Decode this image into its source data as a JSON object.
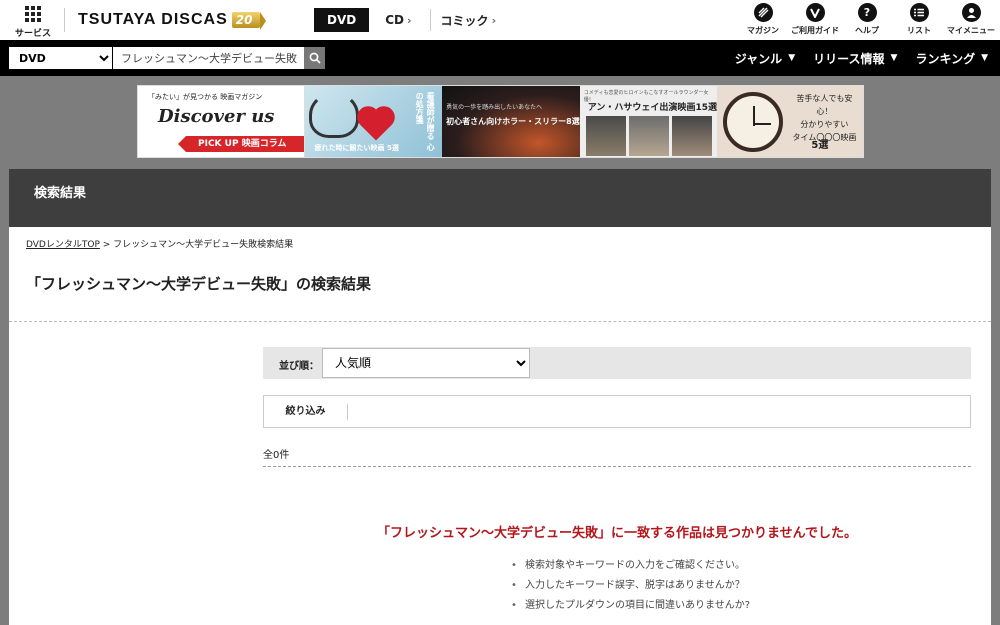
{
  "header": {
    "services_label": "サービス",
    "logo_text": "TSUTAYA DISCAS",
    "logo_badge": "20",
    "category_tabs": [
      {
        "label": "DVD"
      },
      {
        "label": "CD"
      },
      {
        "label": "コミック"
      }
    ],
    "util_nav": [
      {
        "label": "マガジン",
        "icon": "magazine-icon"
      },
      {
        "label": "ご利用ガイド",
        "icon": "guide-icon"
      },
      {
        "label": "ヘルプ",
        "icon": "help-icon"
      },
      {
        "label": "リスト",
        "icon": "list-icon"
      },
      {
        "label": "マイメニュー",
        "icon": "user-icon"
      }
    ]
  },
  "searchbar": {
    "media_selected": "DVD",
    "query": "フレッシュマン～大学デビュー失敗",
    "nav": [
      "ジャンル",
      "リリース情報",
      "ランキング"
    ]
  },
  "banners": {
    "b1": {
      "tag": "「みたい」が見つかる 映画マガジン",
      "title": "Discover us",
      "pick": "PICK UP 映画コラム"
    },
    "b2": {
      "vertical": "看護師が贈る 心の処方箋",
      "bottom": "疲れた時に観たい映画 5選"
    },
    "b3": {
      "small": "勇気の一歩を踏み出したいあなたへ",
      "main": "初心者さん向けホラー・スリラー8選"
    },
    "b4": {
      "small": "コメディも恋愛のヒロインもこなすオールラウンダー女優！",
      "main": "アン・ハサウェイ出演映画15選"
    },
    "b5": {
      "line1": "苦手な人でも安心！",
      "line2": "分かりやすい",
      "line3": "タイム〇〇〇映画",
      "num": "5選"
    }
  },
  "results": {
    "panel_title": "検索結果",
    "breadcrumb_link": "DVDレンタルTOP",
    "breadcrumb_current": " > フレッシュマン～大学デビュー失敗検索結果",
    "page_title": "「フレッシュマン～大学デビュー失敗」の検索結果",
    "sort_label": "並び順：",
    "sort_selected": "人気順",
    "filter_label": "絞り込み",
    "count": "全0件",
    "no_results": "「フレッシュマン～大学デビュー失敗」に一致する作品は見つかりませんでした。",
    "tips": [
      "検索対象やキーワードの入力をご確認ください。",
      "入力したキーワード誤字、脱字はありませんか？",
      "選択したプルダウンの項目に間違いありませんか?"
    ]
  }
}
